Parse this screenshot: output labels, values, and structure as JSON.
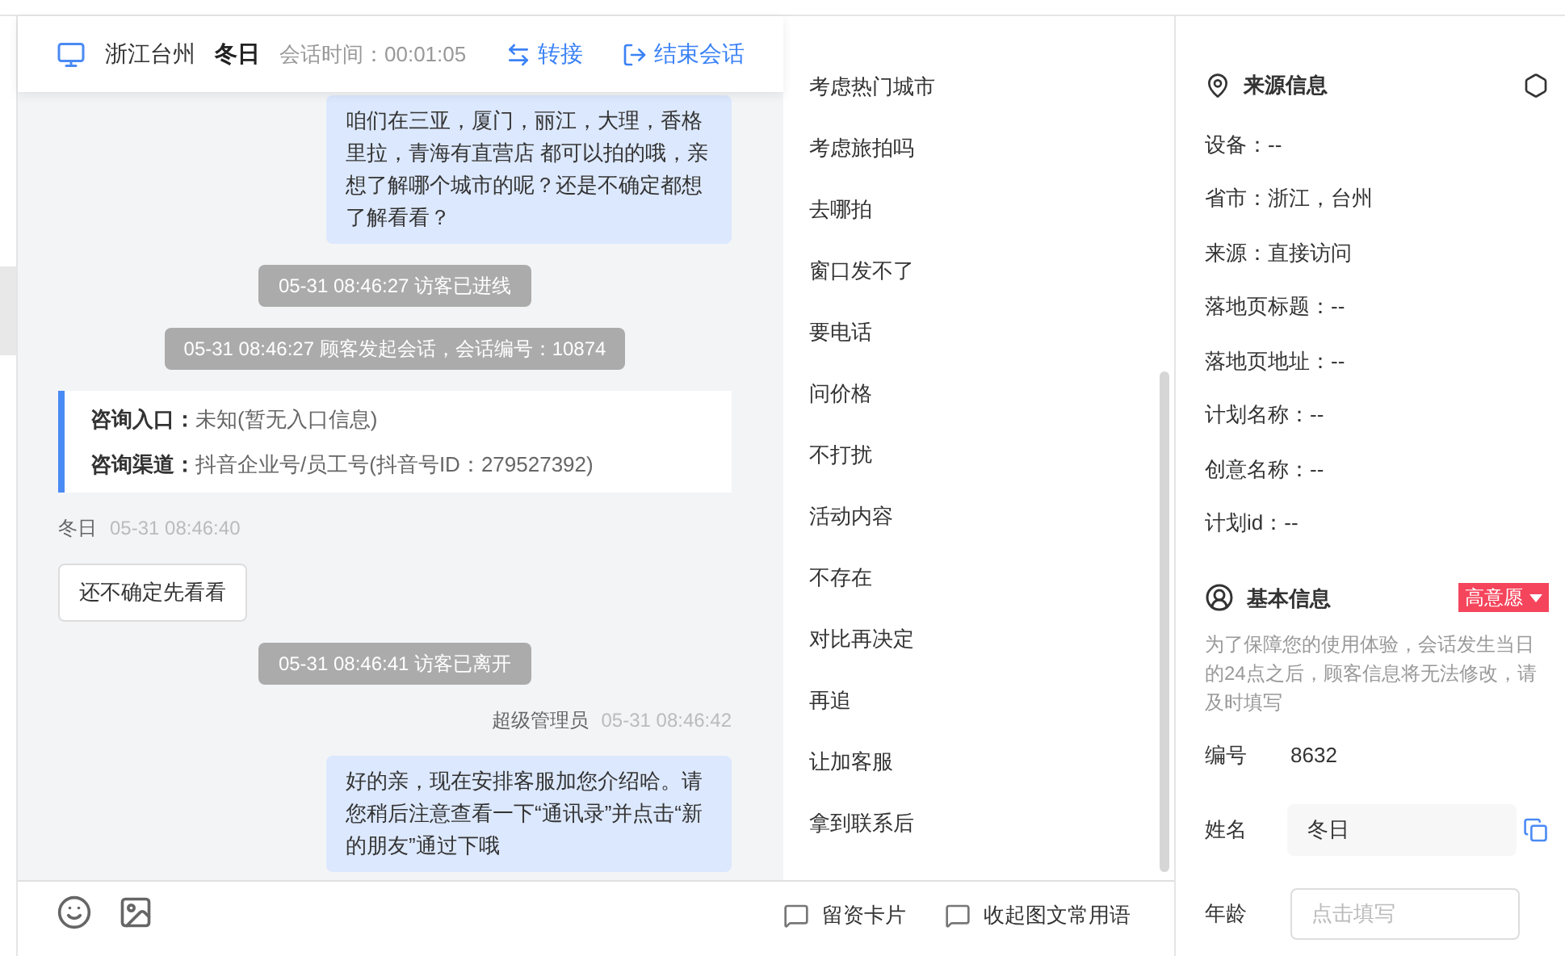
{
  "header": {
    "location": "浙江台州",
    "visitor": "冬日",
    "duration_label": "会话时间：00:01:05",
    "actions": [
      {
        "kind": "transfer",
        "label": "转接"
      },
      {
        "kind": "end",
        "label": "结束会话"
      }
    ]
  },
  "messages": [
    {
      "kind": "agent_bubble",
      "text": "咱们在三亚，厦门，丽江，大理，香格里拉，青海有直营店 都可以拍的哦，亲想了解哪个城市的呢？还是不确定都想了解看看？"
    },
    {
      "kind": "system",
      "text": "05-31 08:46:27 访客已进线"
    },
    {
      "kind": "system",
      "text": "05-31 08:46:27 顾客发起会话，会话编号：10874"
    },
    {
      "kind": "info_card",
      "rows": [
        {
          "label": "咨询入口：",
          "value": "未知(暂无入口信息)"
        },
        {
          "label": "咨询渠道：",
          "value": "抖音企业号/员工号(抖音号ID：279527392)"
        }
      ]
    },
    {
      "kind": "visitor_meta",
      "name": "冬日",
      "time": "05-31 08:46:40"
    },
    {
      "kind": "visitor_bubble",
      "text": "还不确定先看看"
    },
    {
      "kind": "system",
      "text": "05-31 08:46:41 访客已离开"
    },
    {
      "kind": "agent_meta",
      "name": "超级管理员",
      "time": "05-31 08:46:42"
    },
    {
      "kind": "agent_bubble",
      "text": "好的亲，现在安排客服加您介绍哈。请您稍后注意查看一下“通讯录”并点击“新的朋友”通过下哦"
    }
  ],
  "phrases": [
    "考虑热门城市",
    "考虑旅拍吗",
    "去哪拍",
    "窗口发不了",
    "要电话",
    "问价格",
    "不打扰",
    "活动内容",
    "不存在",
    "对比再决定",
    "再追",
    "让加客服",
    "拿到联系后"
  ],
  "phrase_actions": [
    "留资卡片",
    "收起图文常用语"
  ],
  "source_info": {
    "title": "来源信息",
    "rows": [
      "设备：--",
      "省市：浙江，台州",
      "来源：直接访问",
      "落地页标题：--",
      "落地页地址：--",
      "计划名称：--",
      "创意名称：--",
      "计划id：--"
    ]
  },
  "basic_info": {
    "title": "基本信息",
    "intent_tag": "高意愿",
    "notice": "为了保障您的使用体验，会话发生当日的24点之后，顾客信息将无法修改，请及时填写",
    "fields": [
      {
        "kind": "text",
        "label": "编号",
        "value": "8632"
      },
      {
        "kind": "input",
        "label": "姓名",
        "value": "冬日"
      },
      {
        "kind": "input",
        "label": "年龄",
        "placeholder": "点击填写"
      }
    ]
  }
}
